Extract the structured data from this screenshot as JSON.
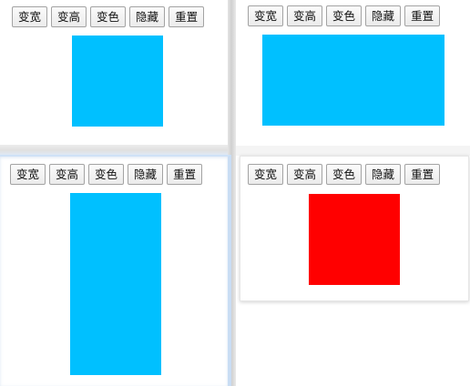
{
  "panels": [
    {
      "buttons": {
        "widen": "变宽",
        "heighten": "变高",
        "recolor": "变色",
        "hide": "隐藏",
        "reset": "重置"
      },
      "box_color": "#00c0ff"
    },
    {
      "buttons": {
        "widen": "变宽",
        "heighten": "变高",
        "recolor": "变色",
        "hide": "隐藏",
        "reset": "重置"
      },
      "box_color": "#00c0ff"
    },
    {
      "buttons": {
        "widen": "变宽",
        "heighten": "变高",
        "recolor": "变色",
        "hide": "隐藏",
        "reset": "重置"
      },
      "box_color": "#00c0ff"
    },
    {
      "buttons": {
        "widen": "变宽",
        "heighten": "变高",
        "recolor": "变色",
        "hide": "隐藏",
        "reset": "重置"
      },
      "box_color": "#ff0000"
    }
  ]
}
